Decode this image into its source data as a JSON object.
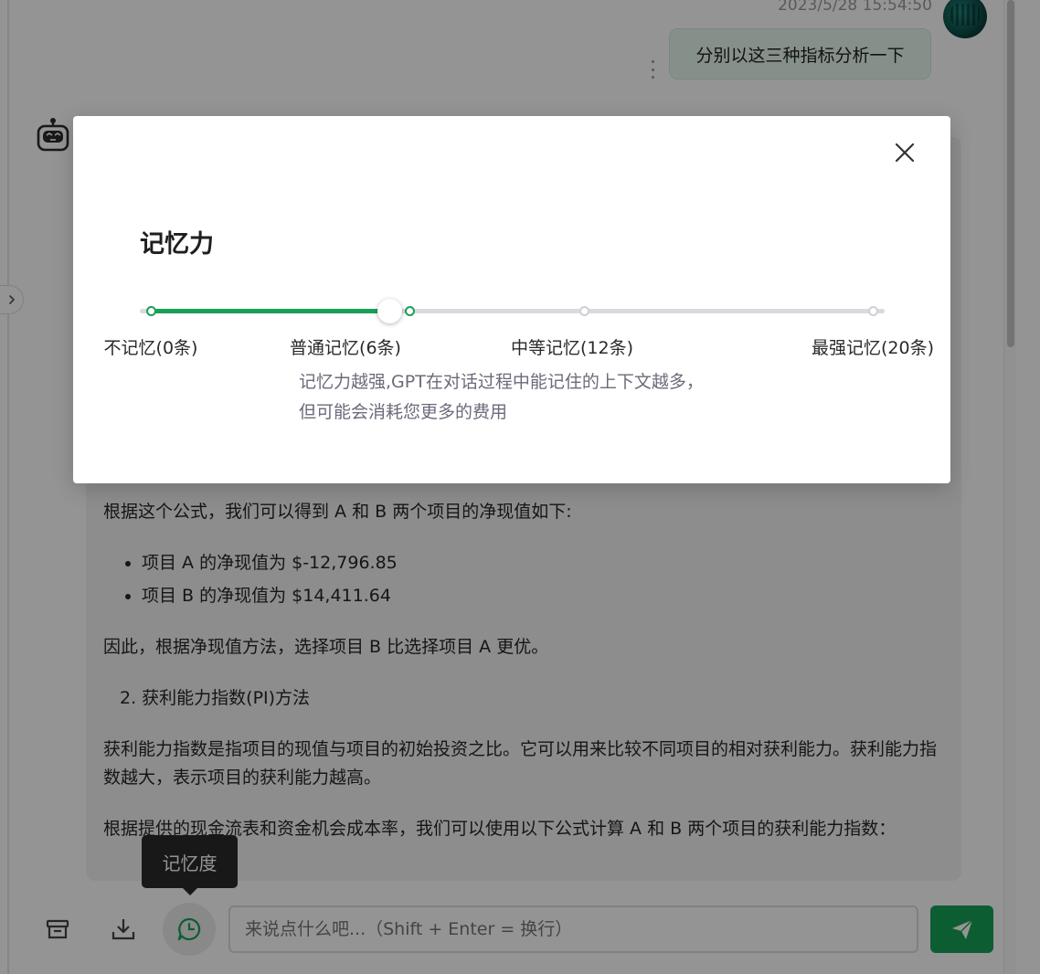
{
  "chat": {
    "user_message": {
      "timestamp": "2023/5/28 15:54:50",
      "text": "分别以这三种指标分析一下"
    },
    "bot_message": {
      "formula_intro": "根据这个公式，我们可以得到 A 和 B 两个项目的净现值如下:",
      "npv_items": [
        "项目 A 的净现值为 $-12,796.85",
        "项目 B 的净现值为 $14,411.64"
      ],
      "npv_conclusion": "因此，根据净现值方法，选择项目 B 比选择项目 A 更优。",
      "pi_heading": "2. 获利能力指数(PI)方法",
      "pi_definition": "获利能力指数是指项目的现值与项目的初始投资之比。它可以用来比较不同项目的相对获利能力。获利能力指数越大，表示项目的获利能力越高。",
      "pi_formula_intro": "根据提供的现金流表和资金机会成本率，我们可以使用以下公式计算 A 和 B 两个项目的获利能力指数："
    }
  },
  "input": {
    "placeholder": "来说点什么吧...（Shift + Enter = 换行）"
  },
  "tooltip": {
    "text": "记忆度"
  },
  "modal": {
    "title": "记忆力",
    "slider": {
      "selected_index": 1,
      "marks": [
        {
          "label": "不记忆(0条)",
          "value": 0
        },
        {
          "label": "普通记忆(6条)",
          "value": 6
        },
        {
          "label": "中等记忆(12条)",
          "value": 12
        },
        {
          "label": "最强记忆(20条)",
          "value": 20
        }
      ],
      "max": 20
    },
    "description": "记忆力越强,GPT在对话过程中能记住的上下文越多，但可能会消耗您更多的费用"
  },
  "colors": {
    "accent": "#18a058",
    "user_bubble": "#e7f8ee",
    "bot_bubble": "#f3f3f3",
    "description_text": "#6b6b7b"
  },
  "icons": {
    "collapse": "chevron-right-icon",
    "bot_avatar": "robot-icon",
    "archive": "archive-icon",
    "download": "download-icon",
    "memory": "memory-icon",
    "send": "send-icon",
    "close": "close-icon"
  }
}
